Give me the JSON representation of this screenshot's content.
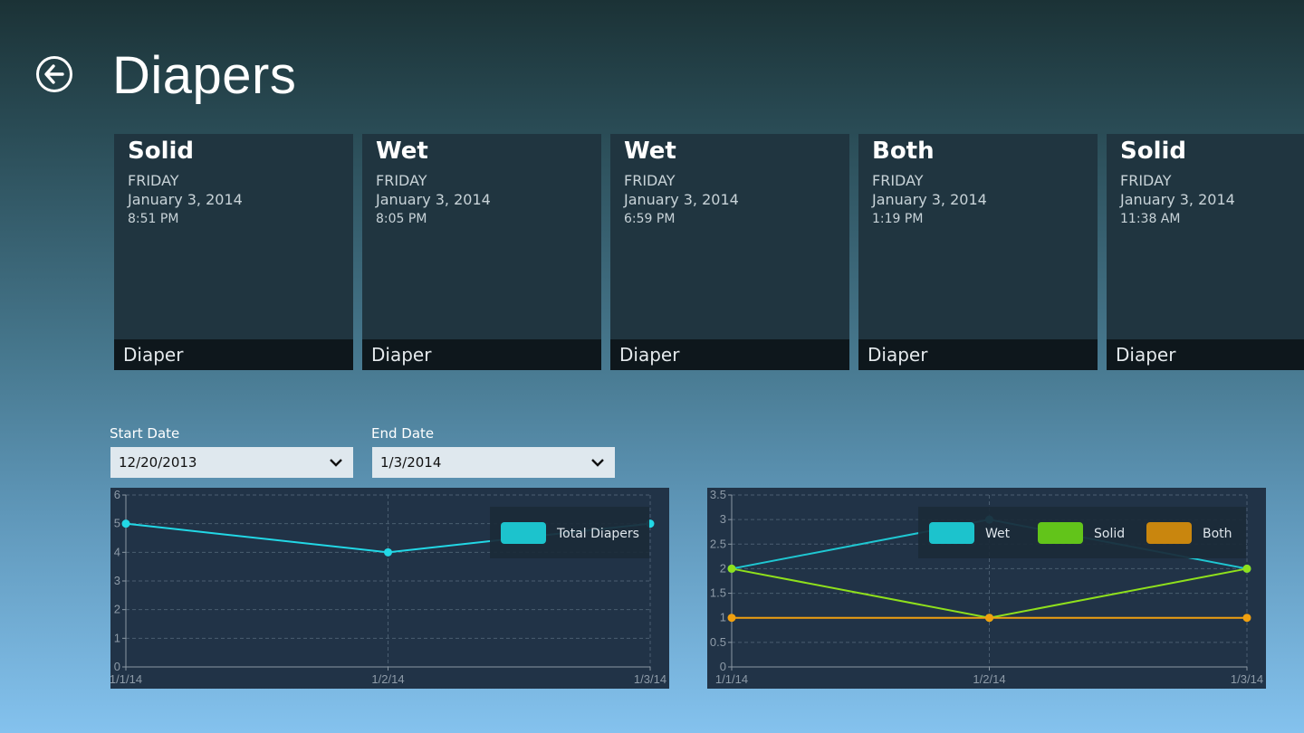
{
  "header": {
    "title": "Diapers",
    "back_icon": "arrow-left-circle-icon"
  },
  "tiles": [
    {
      "type": "Solid",
      "day": "FRIDAY",
      "date": "January 3, 2014",
      "time": "8:51 PM",
      "footer": "Diaper"
    },
    {
      "type": "Wet",
      "day": "FRIDAY",
      "date": "January 3, 2014",
      "time": "8:05 PM",
      "footer": "Diaper"
    },
    {
      "type": "Wet",
      "day": "FRIDAY",
      "date": "January 3, 2014",
      "time": "6:59 PM",
      "footer": "Diaper"
    },
    {
      "type": "Both",
      "day": "FRIDAY",
      "date": "January 3, 2014",
      "time": "1:19 PM",
      "footer": "Diaper"
    },
    {
      "type": "Solid",
      "day": "FRIDAY",
      "date": "January 3, 2014",
      "time": "11:38 AM",
      "footer": "Diaper"
    }
  ],
  "filters": {
    "start": {
      "label": "Start Date",
      "value": "12/20/2013"
    },
    "end": {
      "label": "End Date",
      "value": "1/3/2014"
    }
  },
  "chart_data": [
    {
      "type": "line",
      "x": [
        "1/1/14",
        "1/2/14",
        "1/3/14"
      ],
      "series": [
        {
          "name": "Total Diapers",
          "values": [
            5,
            4,
            5
          ],
          "color": "#22d8e6",
          "legend_color": "#1cc3cd"
        }
      ],
      "ylim": [
        0,
        6
      ],
      "yticks": [
        "0",
        "1",
        "2",
        "3",
        "4",
        "5",
        "6"
      ],
      "legend": "top-right",
      "grid": true
    },
    {
      "type": "line",
      "x": [
        "1/1/14",
        "1/2/14",
        "1/3/14"
      ],
      "series": [
        {
          "name": "Wet",
          "values": [
            2,
            3,
            2
          ],
          "color": "#1fc7d2",
          "legend_color": "#1cc3cd"
        },
        {
          "name": "Solid",
          "values": [
            2,
            1,
            2
          ],
          "color": "#8fe01c",
          "legend_color": "#62c41a"
        },
        {
          "name": "Both",
          "values": [
            1,
            1,
            1
          ],
          "color": "#f0a010",
          "legend_color": "#c9860e"
        }
      ],
      "ylim": [
        0,
        3.5
      ],
      "yticks": [
        "0",
        "0.5",
        "1",
        "1.5",
        "2",
        "2.5",
        "3",
        "3.5"
      ],
      "legend": "top-right",
      "grid": true
    }
  ]
}
